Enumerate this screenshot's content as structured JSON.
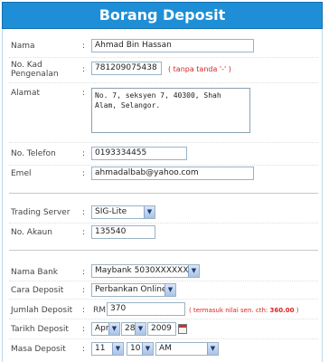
{
  "title": "Borang Deposit",
  "form": {
    "nama": {
      "label": "Nama",
      "value": "Ahmad Bin Hassan"
    },
    "kad": {
      "label": "No. Kad Pengenalan",
      "value": "781209075438",
      "hint": "( tanpa tanda '-' )"
    },
    "alamat": {
      "label": "Alamat",
      "value": "No. 7, seksyen 7, 40300, Shah Alam, Selangor."
    },
    "telefon": {
      "label": "No. Telefon",
      "value": "0193334455"
    },
    "emel": {
      "label": "Emel",
      "value": "ahmadalbab@yahoo.com"
    },
    "server": {
      "label": "Trading Server",
      "value": "SIG-Lite"
    },
    "akaun": {
      "label": "No. Akaun",
      "value": "135540"
    },
    "bank": {
      "label": "Nama Bank",
      "value": "Maybank 5030XXXXXXX"
    },
    "cara": {
      "label": "Cara Deposit",
      "value": "Perbankan Online"
    },
    "jumlah": {
      "label": "Jumlah Deposit",
      "currency": "RM",
      "value": "370",
      "hint_prefix": "( termasuk nilai sen. cth: ",
      "hint_example": "360.00",
      "hint_suffix": " )"
    },
    "tarikh": {
      "label": "Tarikh Deposit",
      "month": "Apr",
      "day": "28",
      "year": "2009"
    },
    "masa": {
      "label": "Masa Deposit",
      "hour": "11",
      "minute": "10",
      "ampm": "AM"
    }
  },
  "colon": ":",
  "icons": {
    "calendar": "calendar-icon",
    "dropdown": "chevron-down-icon"
  },
  "colors": {
    "header_bg": "#1e8fd6",
    "hint": "#dd2222"
  }
}
